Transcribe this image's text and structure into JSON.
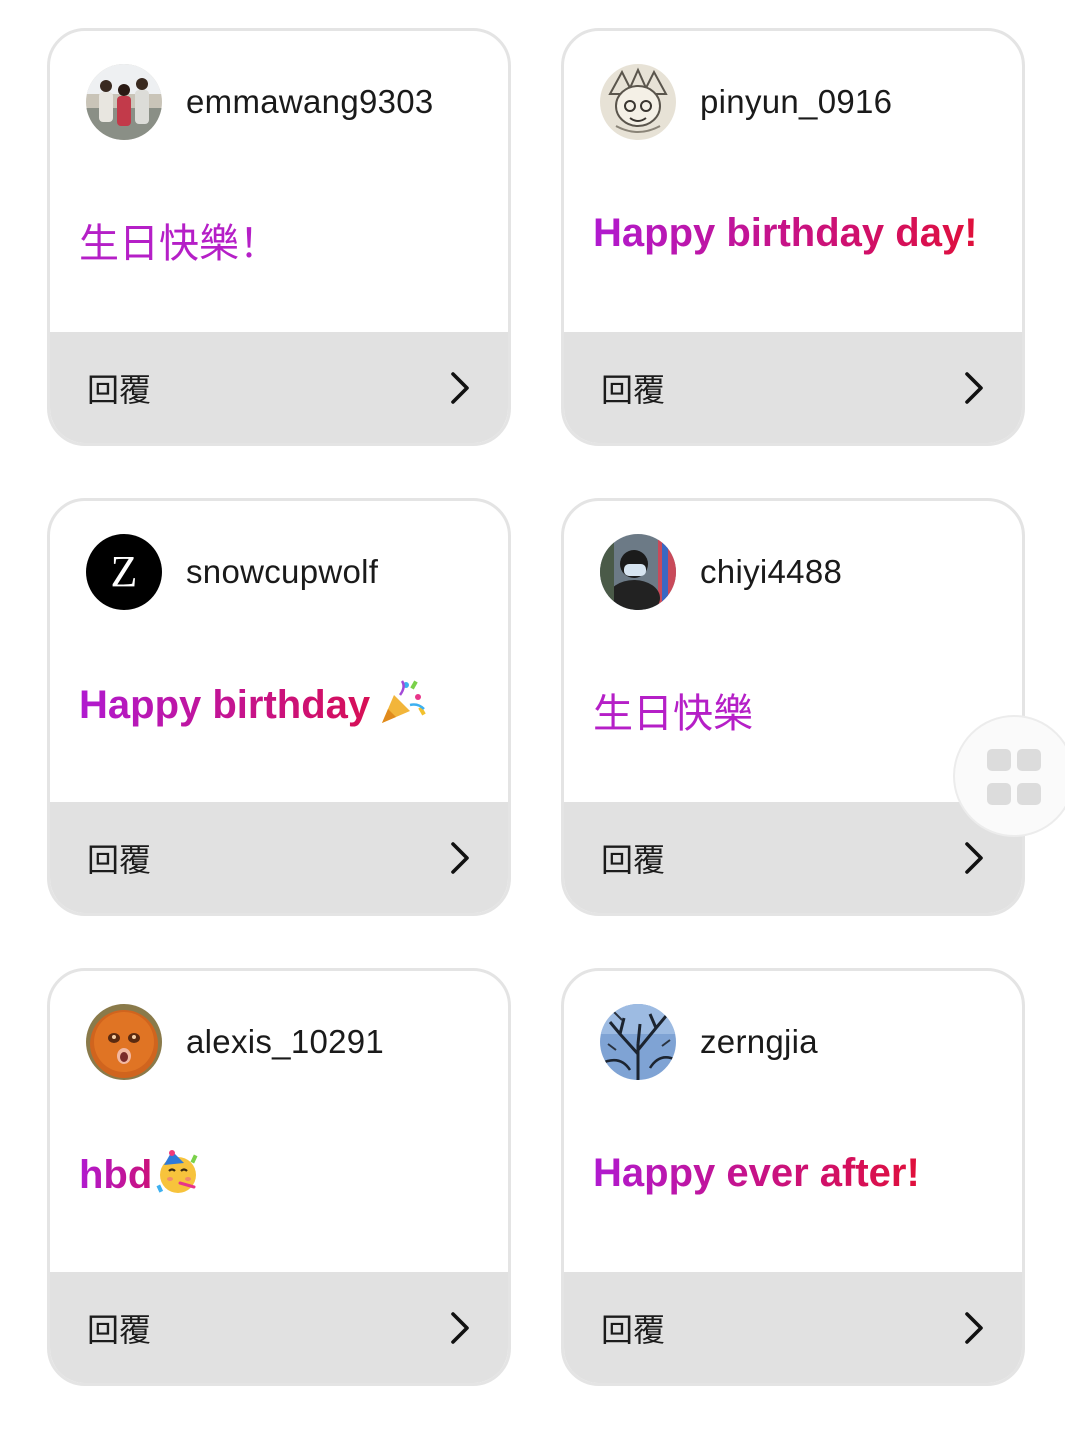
{
  "reply_label": "回覆",
  "cards": [
    {
      "username": "emmawang9303",
      "message": "生日快樂！",
      "avatar": "photo-three-people"
    },
    {
      "username": "pinyun_0916",
      "message": "Happy birthday day!",
      "avatar": "cartoon-drawing"
    },
    {
      "username": "snowcupwolf",
      "message": "Happy birthday",
      "avatar": "letter-z",
      "avatar_letter": "Z",
      "emoji": "party-popper-emoji"
    },
    {
      "username": "chiyi4488",
      "message": "生日快樂",
      "avatar": "photo-person-mask"
    },
    {
      "username": "alexis_10291",
      "message": "hbd",
      "avatar": "orange-face",
      "emoji": "partying-face-emoji"
    },
    {
      "username": "zerngjia",
      "message": "Happy ever after!",
      "avatar": "tree-branches"
    }
  ],
  "floating_button": {
    "icon": "grid-icon"
  },
  "colors": {
    "message_gradient_start": "#b01ad0",
    "message_gradient_end": "#e0103a",
    "footer_bg": "#e1e1e1",
    "card_border": "#e4e4e4"
  }
}
